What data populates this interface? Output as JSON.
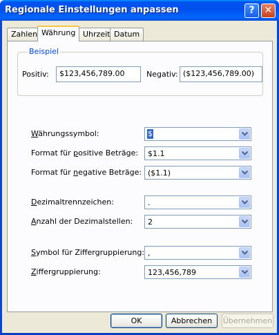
{
  "window": {
    "title": "Regionale Einstellungen anpassen",
    "help_label": "?",
    "close_label": "✕"
  },
  "tabs": [
    {
      "label": "Zahlen",
      "active": false
    },
    {
      "label": "Währung",
      "active": true
    },
    {
      "label": "Uhrzeit",
      "active": false
    },
    {
      "label": "Datum",
      "active": false
    }
  ],
  "example": {
    "legend": "Beispiel",
    "positive_label": "Positiv:",
    "positive_value": "$123,456,789.00",
    "negative_label": "Negativ:",
    "negative_value": "($123,456,789.00)"
  },
  "settings": {
    "currency_symbol": {
      "label": "Währungssymbol:",
      "value": "$"
    },
    "positive_format": {
      "label": "Format für positive Beträge:",
      "value": "$1.1"
    },
    "negative_format": {
      "label": "Format für negative Beträge:",
      "value": "($1.1)"
    },
    "decimal_separator": {
      "label": "Dezimaltrennzeichen:",
      "value": "."
    },
    "decimal_places": {
      "label": "Anzahl der Dezimalstellen:",
      "value": "2"
    },
    "grouping_symbol": {
      "label": "Symbol für Ziffergruppierung:",
      "value": ","
    },
    "digit_grouping": {
      "label": "Ziffergruppierung:",
      "value": "123,456,789"
    }
  },
  "buttons": {
    "ok": "OK",
    "cancel": "Abbrechen",
    "apply": "Übernehmen"
  },
  "colors": {
    "title_bar": "#0054e3",
    "legend": "#0046d5",
    "selection": "#316ac5"
  }
}
